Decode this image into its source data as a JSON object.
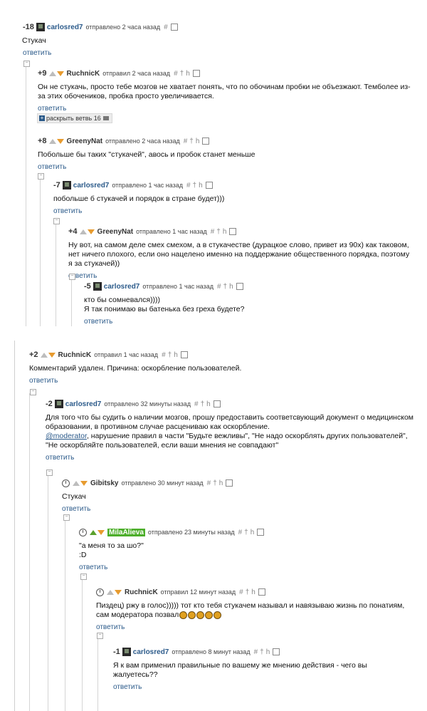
{
  "reply_label": "ответить",
  "expand": {
    "label": "раскрыть ветвь",
    "count": "16"
  },
  "comments": [
    {
      "score": "-18",
      "user": "carlosred7",
      "meta": "отправлено 2 часа назад",
      "text": "Стукач"
    },
    {
      "score": "+9",
      "user": "RuchnicK",
      "meta": "отправил 2 часа назад",
      "text": "Он не стукачь, просто тебе мозгов не хватает понять, что по обочинам пробки не объезжают. Темболее из-за этих обочеников, пробка просто увеличивается."
    },
    {
      "score": "+8",
      "user": "GreenyNat",
      "meta": "отправлено 2 часа назад",
      "text": "Побольше бы таких \"стукачей\", авось и пробок станет меньше"
    },
    {
      "score": "-7",
      "user": "carlosred7",
      "meta": "отправлено 1 час назад",
      "text": "побольше б стукачей и порядок в стране будет)))"
    },
    {
      "score": "+4",
      "user": "GreenyNat",
      "meta": "отправлено 1 час назад",
      "text": "Ну вот, на самом деле смех смехом, а в стукачестве (дурацкое слово, привет из 90х) как таковом, нет ничего плохого, если оно нацелено именно на поддержание общественного порядка, поэтому я за стукачей))"
    },
    {
      "score": "-5",
      "user": "carlosred7",
      "meta": "отправлено 1 час назад",
      "text1": "кто бы сомневался))))",
      "text2": "Я так понимаю вы батенька без греха будете?"
    },
    {
      "score": "+2",
      "user": "RuchnicK",
      "meta": "отправил 1 час назад",
      "text": "Комментарий удален. Причина: оскорбление пользователей."
    },
    {
      "score": "-2",
      "user": "carlosred7",
      "meta": "отправлено 32 минуты назад",
      "text1": "Для того что бы судить о наличии мозгов, прошу предоставить соответсвующий документ о медицинском образовании, в противном случае расцениваю как оскорбление.",
      "mention": "@moderator",
      "text2": ", нарушение правил в части \"Будьте вежливы\", \"Не надо оскорблять других пользователей\", \"Не оскорбляйте пользователей, если ваши мнения не совпадают\""
    },
    {
      "user": "Gibitsky",
      "meta": "отправлено 30 минут назад",
      "text": "Стукач"
    },
    {
      "user": "MilaAlieva",
      "meta": "отправлено 23 минуты назад",
      "text1": "\"а меня то за шо?\"",
      "text2": ":D"
    },
    {
      "user": "RuchnicK",
      "meta": "отправил 12 минут назад",
      "text": "Пиздец) ржу в голос))))) тот кто тебя стукачем называл и навязываю жизнь по понатиям, сам модератора позвал"
    },
    {
      "score": "-1",
      "user": "carlosred7",
      "meta": "отправлено 8 минут назад",
      "text": "Я к вам применил правильные по вашему же мнению действия - чего вы жалуетесь??"
    }
  ]
}
